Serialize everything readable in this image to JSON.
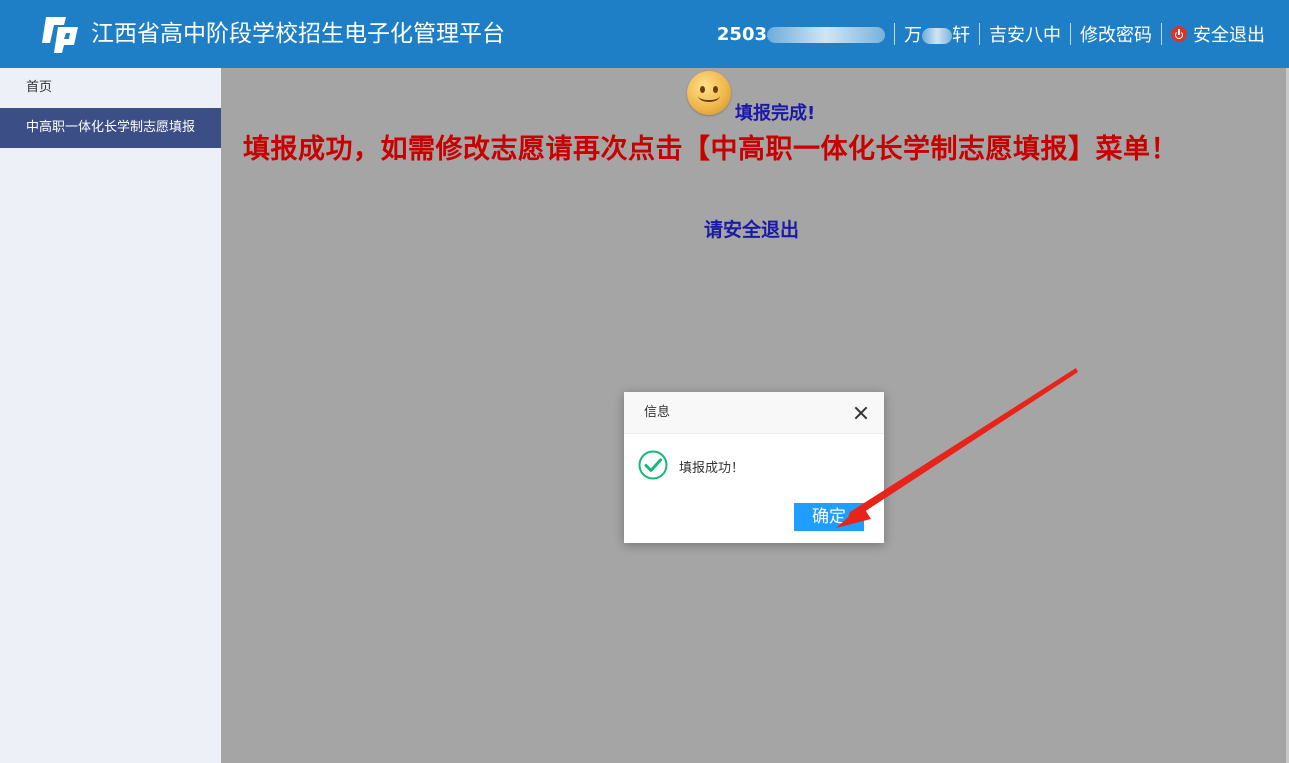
{
  "header": {
    "app_title": "江西省高中阶段学校招生电子化管理平台",
    "user_id_prefix": "2503",
    "user_name_prefix": "万",
    "user_name_suffix": "轩",
    "school": "吉安八中",
    "change_password": "修改密码",
    "logout": "安全退出",
    "icons": {
      "logo": "platform-logo-icon",
      "logout": "power-icon"
    },
    "bg_color": "#1e7fc6"
  },
  "sidebar": {
    "items": [
      {
        "label": "首页",
        "active": false
      },
      {
        "label": "中高职一体化长学制志愿填报",
        "active": true
      }
    ],
    "active_color": "#3b4f86"
  },
  "main": {
    "done_text": "填报完成!",
    "success_message": "填报成功，如需修改志愿请再次点击【中高职一体化长学制志愿填报】菜单！",
    "exit_hint": "请安全退出",
    "icons": {
      "smiley": "smiley-icon"
    }
  },
  "dialog": {
    "title": "信息",
    "message": "填报成功！",
    "ok_label": "确定",
    "icons": {
      "close": "close-icon",
      "status": "check-circle-icon"
    },
    "button_color": "#1e9fff"
  }
}
